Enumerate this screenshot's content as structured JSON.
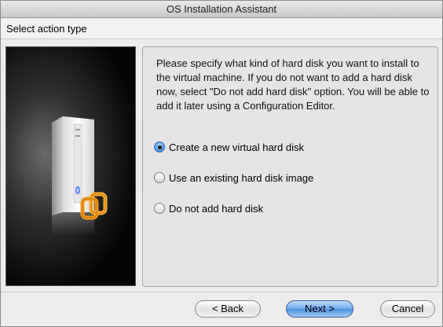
{
  "window": {
    "title": "OS Installation Assistant"
  },
  "header": {
    "section_title": "Select action type"
  },
  "content": {
    "description": "Please specify what kind of hard disk you want to install to the virtual machine. If you do not want to add a hard disk now, select \"Do not add hard disk\" option. You will be able to add it later using a Configuration Editor.",
    "options": [
      {
        "label": "Create a new virtual hard disk",
        "selected": true
      },
      {
        "label": "Use an existing hard disk image",
        "selected": false
      },
      {
        "label": "Do not add hard disk",
        "selected": false
      }
    ]
  },
  "footer": {
    "back_label": "< Back",
    "next_label": "Next >",
    "cancel_label": "Cancel"
  },
  "colors": {
    "accent": "#4e8fde",
    "logo_orange": "#f29a1a"
  },
  "icons": {
    "side_image": "computer-tower-illustration",
    "logo": "parallels-logo-icon"
  }
}
